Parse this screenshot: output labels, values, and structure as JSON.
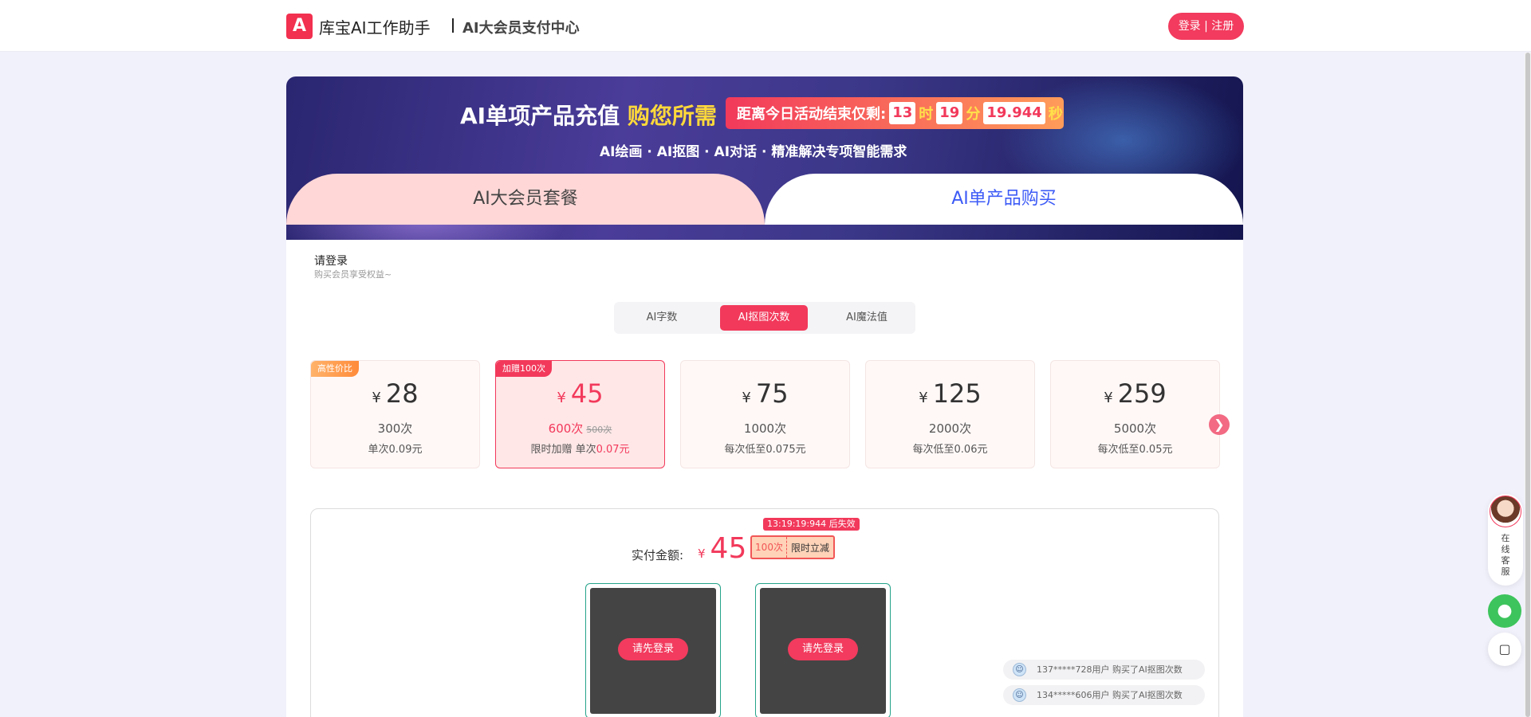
{
  "header": {
    "logo_letter": "A",
    "brand": "库宝AI工作助手",
    "subtitle": "AI大会员支付中心",
    "login_label": "登录 | 注册"
  },
  "banner": {
    "title_plain": "AI单项产品充值",
    "title_highlight": "购您所需",
    "countdown": {
      "prefix": "距离今日活动结束仅剩:",
      "hours": "13",
      "hours_unit": "时",
      "minutes": "19",
      "minutes_unit": "分",
      "seconds": "19.944",
      "seconds_unit": "秒"
    },
    "subtitle": "AI绘画 · AI抠图 ·  AI对话 · 精准解决专项智能需求"
  },
  "main_tabs": {
    "left": "AI大会员套餐",
    "right": "AI单产品购买"
  },
  "login_hint": {
    "title": "请登录",
    "subtitle": "购买会员享受权益~"
  },
  "sub_tabs": [
    {
      "label": "AI字数",
      "active": false
    },
    {
      "label": "AI抠图次数",
      "active": true
    },
    {
      "label": "AI魔法值",
      "active": false
    }
  ],
  "price_cards": [
    {
      "badge": "高性价比",
      "currency": "¥",
      "price": "28",
      "count": "300次",
      "old_count": "",
      "unit_prefix": "单次0.09元",
      "unit_value": "",
      "selected": false
    },
    {
      "badge": "加赠100次",
      "currency": "¥",
      "price": "45",
      "count": "600次",
      "old_count": "500次",
      "unit_prefix": "限时加赠 单次",
      "unit_value": "0.07元",
      "selected": true
    },
    {
      "badge": "",
      "currency": "¥",
      "price": "75",
      "count": "1000次",
      "old_count": "",
      "unit_prefix": "每次低至0.075元",
      "unit_value": "",
      "selected": false
    },
    {
      "badge": "",
      "currency": "¥",
      "price": "125",
      "count": "2000次",
      "old_count": "",
      "unit_prefix": "每次低至0.06元",
      "unit_value": "",
      "selected": false
    },
    {
      "badge": "",
      "currency": "¥",
      "price": "259",
      "count": "5000次",
      "old_count": "",
      "unit_prefix": "每次低至0.05元",
      "unit_value": "",
      "selected": false
    }
  ],
  "payment": {
    "expire_tag": "13:19:19:944 后失效",
    "label": "实付金额:",
    "currency": "¥",
    "amount": "45",
    "promo_left": "100次",
    "promo_right": "限时立减",
    "qr_buttons": [
      "请先登录",
      "请先登录"
    ]
  },
  "tickers": [
    {
      "user": "137*****728用户",
      "action": "购买了AI抠图次数"
    },
    {
      "user": "134*****606用户",
      "action": "购买了AI抠图次数"
    }
  ],
  "float": {
    "cs_label": "在线客服"
  },
  "icons": {
    "next": "chevron-right-icon",
    "wechat": "wechat-icon",
    "chat": "chat-bubble-icon"
  },
  "colors": {
    "accent": "#f2395b",
    "tab_active_bg": "#ffd7d7",
    "tab_link": "#3d5bf6",
    "wechat_green": "#3dc45c"
  }
}
